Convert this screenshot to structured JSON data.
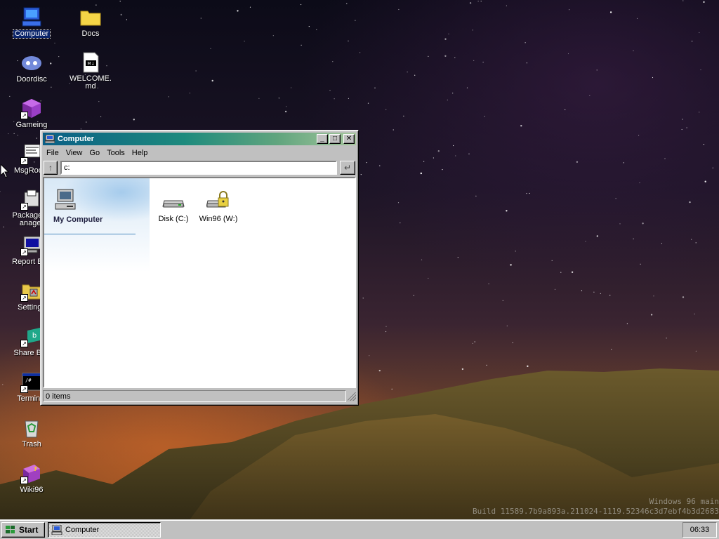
{
  "desktop": {
    "icons": [
      {
        "label": "Computer"
      },
      {
        "label": "Docs"
      },
      {
        "label": "Doordisc"
      },
      {
        "label": "WELCOME.md"
      },
      {
        "label": "Gameing"
      },
      {
        "label": "MsgRoom"
      },
      {
        "label": "Package Manager"
      },
      {
        "label": "Report Bug"
      },
      {
        "label": "Settings"
      },
      {
        "label": "Share Box"
      },
      {
        "label": "Terminal"
      },
      {
        "label": "Trash"
      },
      {
        "label": "Wiki96"
      }
    ],
    "build_info": {
      "line1": "Windows 96 main",
      "line2": "Build 11589.7b9a893a.211024-1119.52346c3d7ebf4b3d2683"
    }
  },
  "window": {
    "title": "Computer",
    "controls": {
      "minimize": "_",
      "maximize": "□",
      "close": "✕"
    },
    "menu": [
      "File",
      "View",
      "Go",
      "Tools",
      "Help"
    ],
    "address": {
      "value": "c:",
      "up_glyph": "↑",
      "go_glyph": "↵"
    },
    "side_panel": {
      "title": "My Computer"
    },
    "items": [
      {
        "label": "Disk (C:)",
        "icon": "disk-drive-icon"
      },
      {
        "label": "Win96 (W:)",
        "icon": "locked-drive-icon"
      }
    ],
    "status": "0 items"
  },
  "taskbar": {
    "start_label": "Start",
    "tasks": [
      {
        "label": "Computer"
      }
    ],
    "clock": "06:33"
  },
  "colors": {
    "titlebar_start": "#0a5f86",
    "titlebar_end": "#a6c79d",
    "selection": "#0a246a",
    "chrome": "#c0c0c0"
  }
}
